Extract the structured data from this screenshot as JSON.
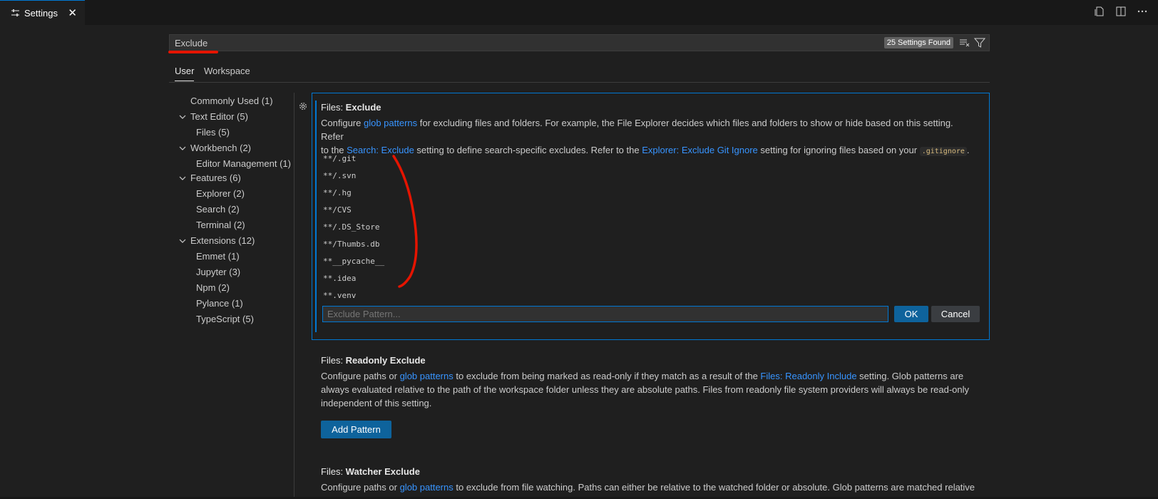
{
  "tab": {
    "label": "Settings",
    "close": "✕"
  },
  "search": {
    "value": "Exclude",
    "found": "25 Settings Found"
  },
  "scope_tabs": {
    "user": "User",
    "workspace": "Workspace"
  },
  "toc": [
    {
      "label": "Commonly Used (1)"
    },
    {
      "label": "Text Editor (5)"
    },
    {
      "label": "Files (5)"
    },
    {
      "label": "Workbench (2)"
    },
    {
      "label": "Editor Management (1)"
    },
    {
      "label": "Features (6)"
    },
    {
      "label": "Explorer (2)"
    },
    {
      "label": "Search (2)"
    },
    {
      "label": "Terminal (2)"
    },
    {
      "label": "Extensions (12)"
    },
    {
      "label": "Emmet (1)"
    },
    {
      "label": "Jupyter (3)"
    },
    {
      "label": "Npm (2)"
    },
    {
      "label": "Pylance (1)"
    },
    {
      "label": "TypeScript (5)"
    }
  ],
  "files_exclude": {
    "category": "Files: ",
    "name": "Exclude",
    "desc_1": "Configure ",
    "link_glob": "glob patterns",
    "desc_2": " for excluding files and folders. For example, the File Explorer decides which files and folders to show or hide based on this setting. Refer",
    "desc_3": "to the ",
    "link_search": "Search: Exclude",
    "desc_4": " setting to define search-specific excludes. Refer to the ",
    "link_explorer": "Explorer: Exclude Git Ignore",
    "desc_5": " setting for ignoring files based on your ",
    "code": ".gitignore",
    "desc_6": ".",
    "patterns": [
      "**/.git",
      "**/.svn",
      "**/.hg",
      "**/CVS",
      "**/.DS_Store",
      "**/Thumbs.db",
      "**__pycache__",
      "**.idea",
      "**.venv"
    ],
    "input_placeholder": "Exclude Pattern...",
    "ok": "OK",
    "cancel": "Cancel"
  },
  "readonly_exclude": {
    "category": "Files: ",
    "name": "Readonly Exclude",
    "desc_1": "Configure paths or ",
    "link_glob": "glob patterns",
    "desc_2": " to exclude from being marked as read-only if they match as a result of the ",
    "link_include": "Files: Readonly Include",
    "desc_3": " setting. Glob patterns are",
    "desc_4": "always evaluated relative to the path of the workspace folder unless they are absolute paths. Files from readonly file system providers will always be read-only",
    "desc_5": "independent of this setting.",
    "button": "Add Pattern"
  },
  "watcher_exclude": {
    "category": "Files: ",
    "name": "Watcher Exclude",
    "desc_1": "Configure paths or ",
    "link_glob": "glob patterns",
    "desc_2": " to exclude from file watching. Paths can either be relative to the watched folder or absolute. Glob patterns are matched relative"
  },
  "colors": {
    "accent": "#0078d4",
    "link": "#3794ff",
    "annotation": "#e51400"
  }
}
